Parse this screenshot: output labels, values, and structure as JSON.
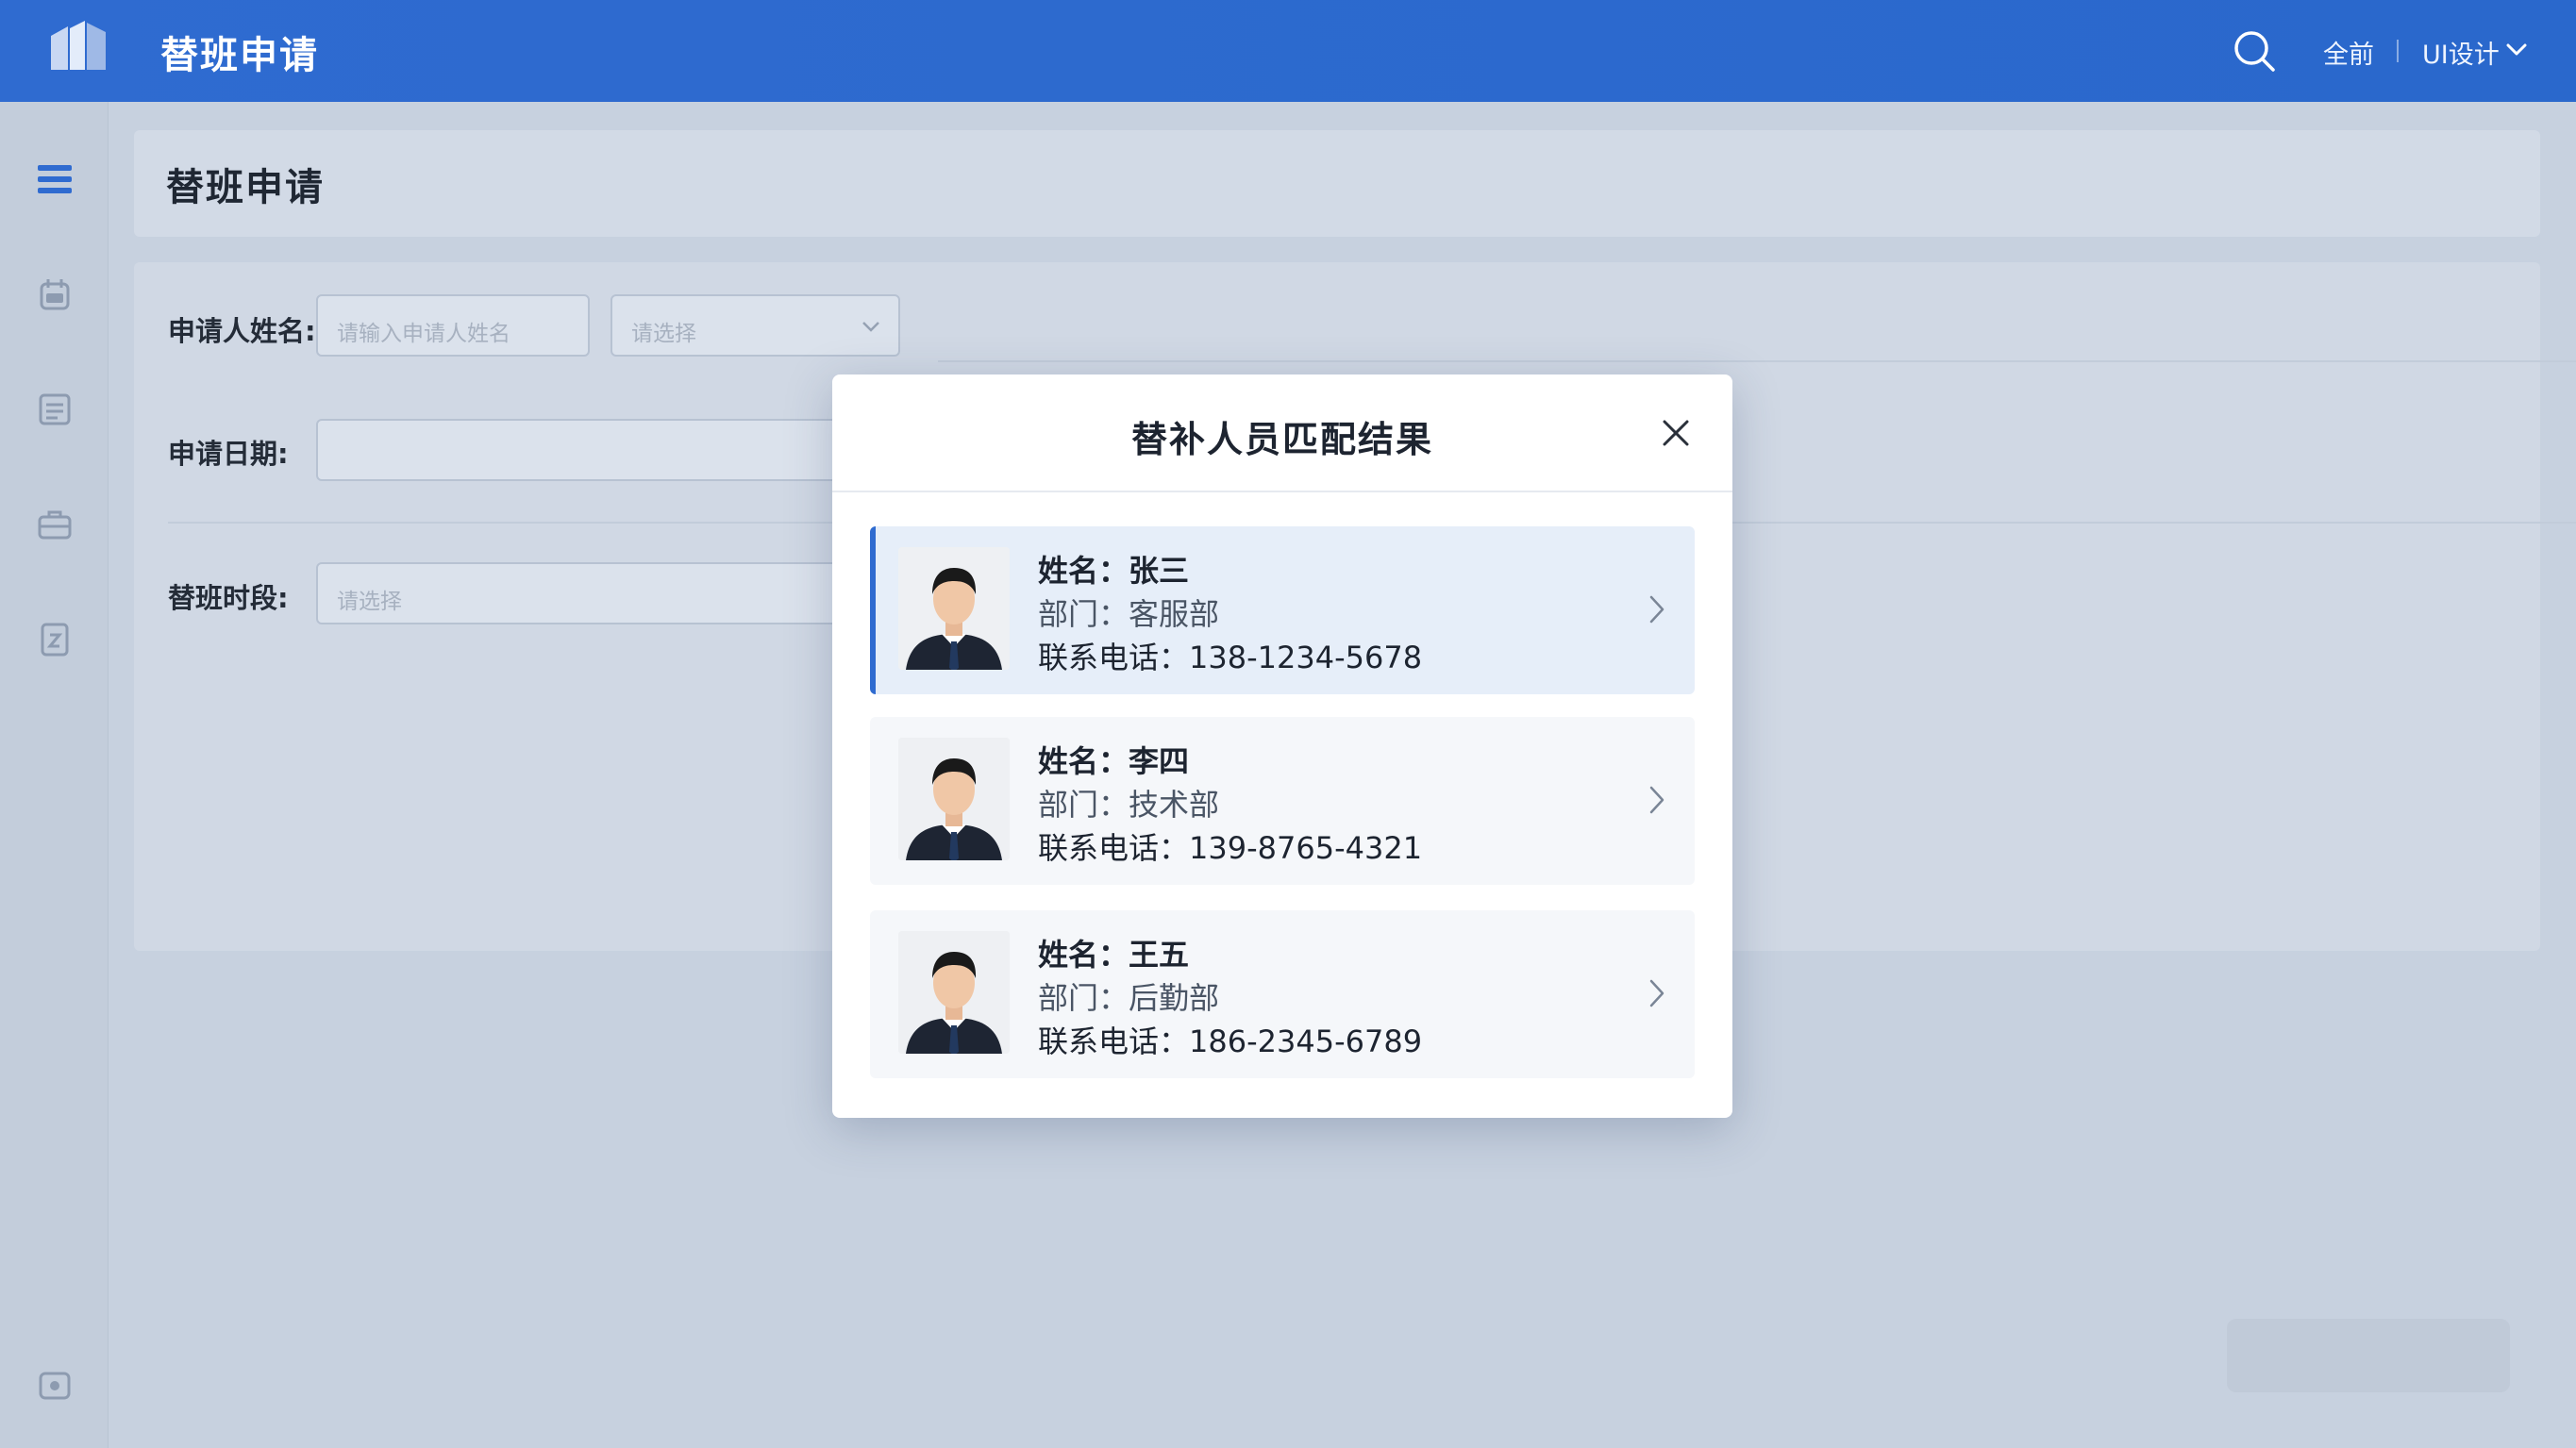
{
  "header": {
    "title": "替班申请",
    "link_all": "全前",
    "user_menu": "UI设计"
  },
  "page": {
    "title": "替班申请"
  },
  "form": {
    "applicant_label": "申请人姓名:",
    "applicant_placeholder": "请输入申请人姓名",
    "applicant_select_placeholder": "请选择",
    "date_label": "申请日期:",
    "slot_label": "替班时段:",
    "slot_placeholder": "请选择"
  },
  "modal": {
    "title": "替补人员匹配结果",
    "candidates": [
      {
        "name": "姓名：张三",
        "dept": "部门：客服部",
        "phone": "联系电话：138-1234-5678",
        "selected": true
      },
      {
        "name": "姓名：李四",
        "dept": "部门：技术部",
        "phone": "联系电话：139-8765-4321",
        "selected": false
      },
      {
        "name": "姓名：王五",
        "dept": "部门：后勤部",
        "phone": "联系电话：186-2345-6789",
        "selected": false
      }
    ]
  },
  "colors": {
    "brand": "#2f6bd0",
    "selected_card": "#e6eef9"
  }
}
